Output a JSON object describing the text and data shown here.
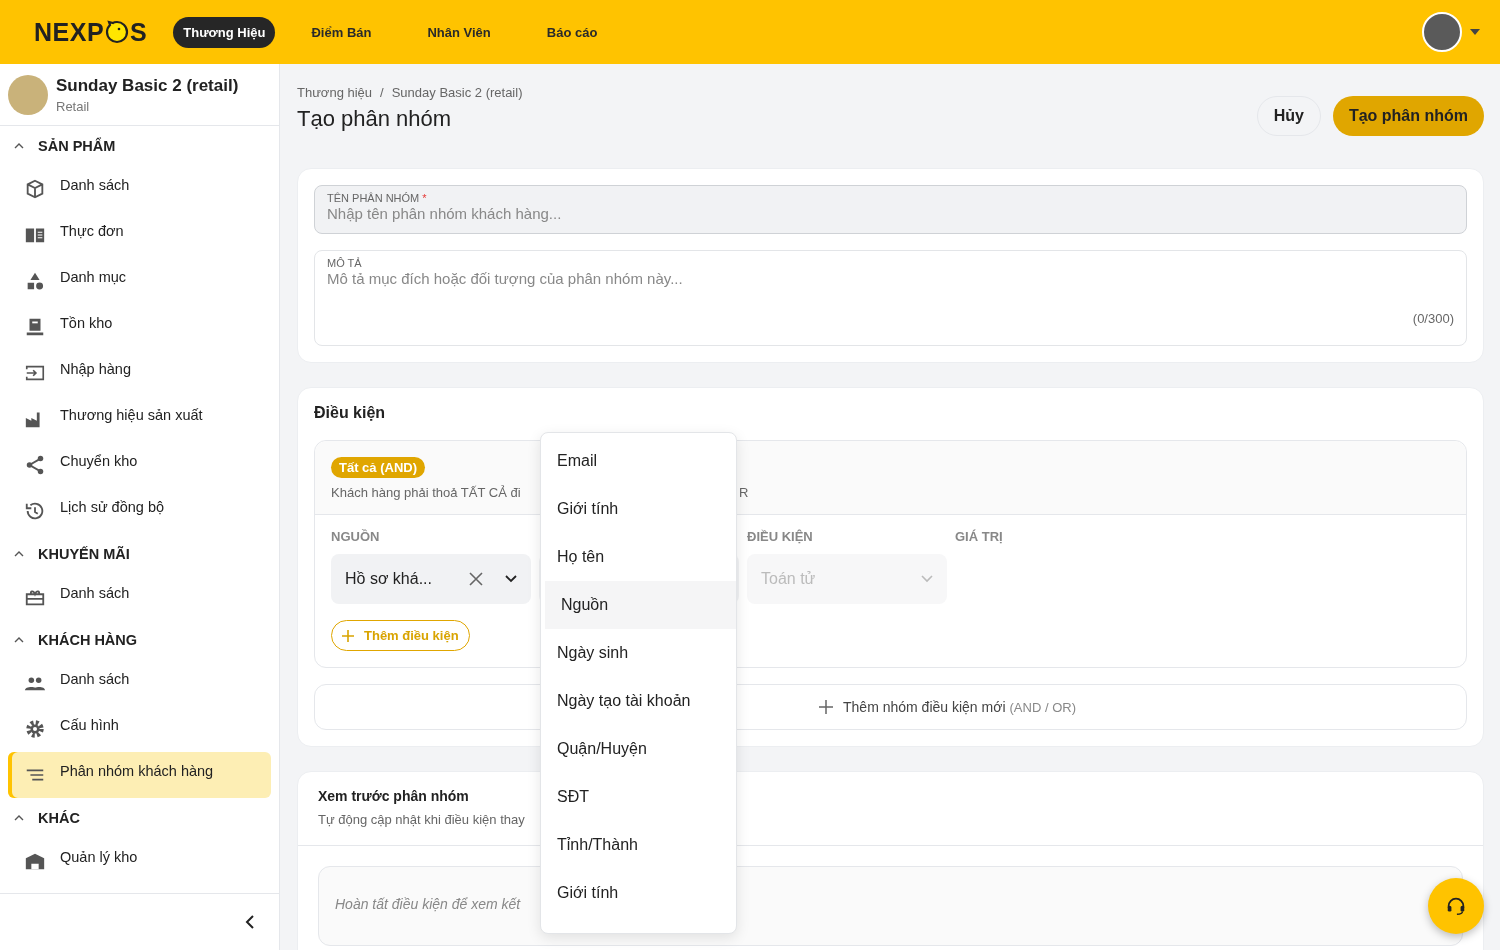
{
  "topbar": {
    "logo_left": "NEXP",
    "logo_right": "S",
    "nav": [
      {
        "label": "Thương Hiệu",
        "selected": true
      },
      {
        "label": "Điểm Bán",
        "selected": false
      },
      {
        "label": "Nhân Viên",
        "selected": false
      },
      {
        "label": "Báo cáo",
        "selected": false
      }
    ]
  },
  "sidebar": {
    "store_name": "Sunday Basic 2 (retail)",
    "store_type": "Retail",
    "sections": [
      {
        "title": "SẢN PHẨM",
        "expanded": true,
        "items": [
          {
            "label": "Danh sách",
            "selected": false
          },
          {
            "label": "Thực đơn",
            "selected": false
          },
          {
            "label": "Danh mục",
            "selected": false
          },
          {
            "label": "Tồn kho",
            "selected": false
          },
          {
            "label": "Nhập hàng",
            "selected": false
          },
          {
            "label": "Thương hiệu sản xuất",
            "selected": false
          },
          {
            "label": "Chuyển kho",
            "selected": false
          },
          {
            "label": "Lịch sử đồng bộ",
            "selected": false
          }
        ]
      },
      {
        "title": "KHUYẾN MÃI",
        "expanded": true,
        "items": [
          {
            "label": "Danh sách",
            "selected": false
          }
        ]
      },
      {
        "title": "KHÁCH HÀNG",
        "expanded": true,
        "items": [
          {
            "label": "Danh sách",
            "selected": false
          },
          {
            "label": "Cấu hình",
            "selected": false
          },
          {
            "label": "Phân nhóm khách hàng",
            "selected": true
          }
        ]
      },
      {
        "title": "KHÁC",
        "expanded": true,
        "items": [
          {
            "label": "Quản lý kho",
            "selected": false
          }
        ]
      }
    ]
  },
  "header": {
    "breadcrumb": [
      "Thương hiệu",
      "Sunday Basic 2 (retail)"
    ],
    "separator": "/",
    "title": "Tạo phân nhóm",
    "cancel": "Hủy",
    "submit": "Tạo phân nhóm"
  },
  "form": {
    "name_label": "TÊN PHÂN NHÓM",
    "required_mark": "*",
    "name_placeholder": "Nhập tên phân nhóm khách hàng...",
    "desc_label": "MÔ TẢ",
    "desc_placeholder": "Mô tả mục đích hoặc đối tượng của phân nhóm này...",
    "counter": "(0/300)"
  },
  "conditions": {
    "title": "Điều kiện",
    "badge": "Tất cả (AND)",
    "hint_visible": "Khách hàng phải thoả TẤT CẢ đi",
    "hint_tail": "R",
    "columns": [
      "NGUỒN",
      "ĐIỀU KIỆN",
      "GIÁ TRỊ"
    ],
    "source_value": "Hồ sơ khá...",
    "operator_placeholder": "Toán tử",
    "add_condition": "Thêm điều kiện",
    "add_group": "Thêm nhóm điều kiện mới",
    "add_group_hint": "(AND / OR)"
  },
  "preview": {
    "title": "Xem trước phân nhóm",
    "subtitle": "Tự động cập nhật khi điều kiện thay",
    "empty": "Hoàn tất điều kiện để xem kết"
  },
  "dropdown": [
    {
      "label": "Email",
      "selected": false
    },
    {
      "label": "Giới tính",
      "selected": false
    },
    {
      "label": "Họ tên",
      "selected": false
    },
    {
      "label": "Nguồn",
      "selected": true
    },
    {
      "label": "Ngày sinh",
      "selected": false
    },
    {
      "label": "Ngày tạo tài khoản",
      "selected": false
    },
    {
      "label": "Quận/Huyện",
      "selected": false
    },
    {
      "label": "SĐT",
      "selected": false
    },
    {
      "label": "Tỉnh/Thành",
      "selected": false
    },
    {
      "label": "Giới tính",
      "selected": false
    }
  ]
}
